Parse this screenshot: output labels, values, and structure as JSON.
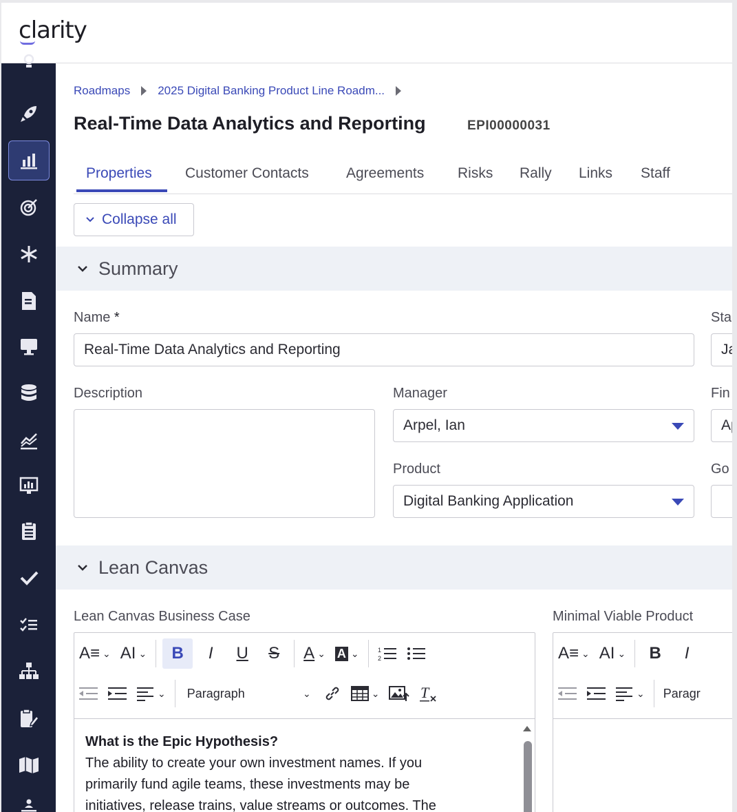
{
  "brand": {
    "logo_text": "clarity",
    "accent": "#3a49b7",
    "sidebar_bg": "#1b2139"
  },
  "sidebar": {
    "items": [
      {
        "icon": "lightbulb-icon"
      },
      {
        "icon": "rocket-icon"
      },
      {
        "icon": "bar-chart-icon",
        "active": true
      },
      {
        "icon": "target-icon"
      },
      {
        "icon": "snowflake-icon"
      },
      {
        "icon": "document-icon"
      },
      {
        "icon": "monitor-icon"
      },
      {
        "icon": "database-icon"
      },
      {
        "icon": "trend-chart-icon"
      },
      {
        "icon": "presentation-icon"
      },
      {
        "icon": "clipboard-icon"
      },
      {
        "icon": "check-icon"
      },
      {
        "icon": "checklist-icon"
      },
      {
        "icon": "org-chart-icon"
      },
      {
        "icon": "clipboard-edit-icon"
      },
      {
        "icon": "map-icon"
      },
      {
        "icon": "user-tree-icon"
      }
    ]
  },
  "breadcrumb": {
    "item1": "Roadmaps",
    "item2": "2025 Digital Banking Product Line Roadm..."
  },
  "page": {
    "title": "Real-Time Data Analytics and Reporting",
    "epic_id": "EPI00000031"
  },
  "tabs": [
    {
      "label": "Properties",
      "active": true
    },
    {
      "label": "Customer Contacts"
    },
    {
      "label": "Agreements"
    },
    {
      "label": "Risks"
    },
    {
      "label": "Rally"
    },
    {
      "label": "Links"
    },
    {
      "label": "Staff"
    }
  ],
  "collapse_all_label": "Collapse all",
  "summary": {
    "header": "Summary",
    "name_label": "Name",
    "required_mark": "*",
    "name_value": "Real-Time Data Analytics and Reporting",
    "start_label_partial": "Sta",
    "start_value_partial": "Ja",
    "description_label": "Description",
    "manager_label": "Manager",
    "manager_value": "Arpel, Ian",
    "fin_label_partial": "Fin",
    "fin_value_partial": "Ap",
    "product_label": "Product",
    "product_value": "Digital Banking Application",
    "go_label_partial": "Go"
  },
  "lean_canvas": {
    "header": "Lean Canvas",
    "business_case_label": "Lean Canvas Business Case",
    "mvp_label": "Minimal Viable Product",
    "paragraph_label": "Paragraph",
    "paragraph_label_partial": "Paragr",
    "content_heading": "What is the Epic Hypothesis?",
    "content_lines": [
      "The ability to create your own investment names. If you",
      "primarily fund agile teams, these investments may be",
      "initiatives, release trains, value streams or outcomes. The"
    ]
  }
}
